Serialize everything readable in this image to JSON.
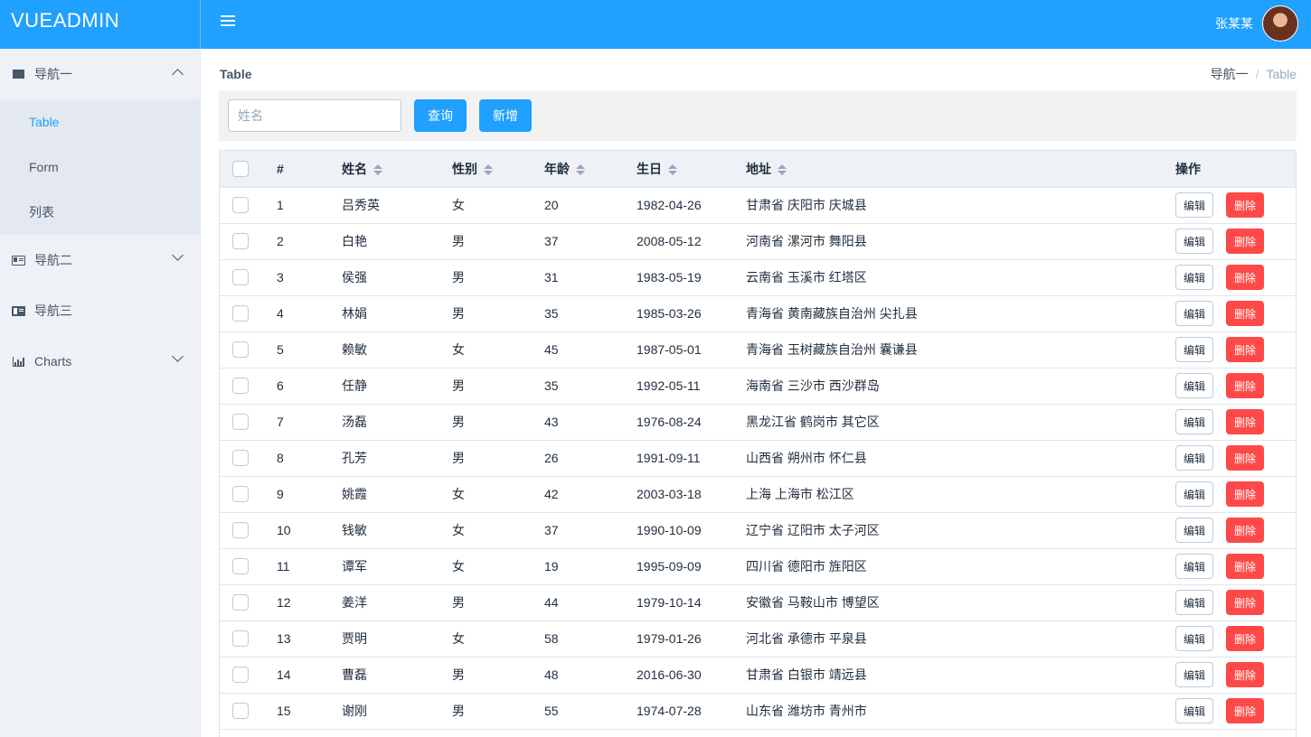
{
  "app": {
    "logo": "VUEADMIN",
    "user_name": "张某某"
  },
  "sidebar": {
    "groups": [
      {
        "label": "导航一",
        "icon": "envelope-icon",
        "expanded": true,
        "items": [
          {
            "label": "Table",
            "active": true
          },
          {
            "label": "Form",
            "active": false
          },
          {
            "label": "列表",
            "active": false
          }
        ]
      },
      {
        "label": "导航二",
        "icon": "id-card-icon",
        "expanded": false,
        "items": []
      },
      {
        "label": "导航三",
        "icon": "id-card-solid-icon",
        "expanded": false,
        "items": []
      },
      {
        "label": "Charts",
        "icon": "bar-chart-icon",
        "expanded": false,
        "items": []
      }
    ]
  },
  "page": {
    "title": "Table",
    "breadcrumb": [
      "导航一",
      "Table"
    ]
  },
  "toolbar": {
    "search_placeholder": "姓名",
    "search_value": "",
    "query_label": "查询",
    "add_label": "新增"
  },
  "table": {
    "columns": [
      "#",
      "姓名",
      "性别",
      "年龄",
      "生日",
      "地址",
      "操作"
    ],
    "sortable": [
      "姓名",
      "性别",
      "年龄",
      "生日",
      "地址"
    ],
    "edit_label": "编辑",
    "delete_label": "删除",
    "rows": [
      {
        "index": "1",
        "name": "吕秀英",
        "gender": "女",
        "age": "20",
        "birthday": "1982-04-26",
        "address": "甘肃省 庆阳市 庆城县"
      },
      {
        "index": "2",
        "name": "白艳",
        "gender": "男",
        "age": "37",
        "birthday": "2008-05-12",
        "address": "河南省 漯河市 舞阳县"
      },
      {
        "index": "3",
        "name": "侯强",
        "gender": "男",
        "age": "31",
        "birthday": "1983-05-19",
        "address": "云南省 玉溪市 红塔区"
      },
      {
        "index": "4",
        "name": "林娟",
        "gender": "男",
        "age": "35",
        "birthday": "1985-03-26",
        "address": "青海省 黄南藏族自治州 尖扎县"
      },
      {
        "index": "5",
        "name": "赖敏",
        "gender": "女",
        "age": "45",
        "birthday": "1987-05-01",
        "address": "青海省 玉树藏族自治州 囊谦县"
      },
      {
        "index": "6",
        "name": "任静",
        "gender": "男",
        "age": "35",
        "birthday": "1992-05-11",
        "address": "海南省 三沙市 西沙群岛"
      },
      {
        "index": "7",
        "name": "汤磊",
        "gender": "男",
        "age": "43",
        "birthday": "1976-08-24",
        "address": "黑龙江省 鹤岗市 其它区"
      },
      {
        "index": "8",
        "name": "孔芳",
        "gender": "男",
        "age": "26",
        "birthday": "1991-09-11",
        "address": "山西省 朔州市 怀仁县"
      },
      {
        "index": "9",
        "name": "姚霞",
        "gender": "女",
        "age": "42",
        "birthday": "2003-03-18",
        "address": "上海 上海市 松江区"
      },
      {
        "index": "10",
        "name": "钱敏",
        "gender": "女",
        "age": "37",
        "birthday": "1990-10-09",
        "address": "辽宁省 辽阳市 太子河区"
      },
      {
        "index": "11",
        "name": "谭军",
        "gender": "女",
        "age": "19",
        "birthday": "1995-09-09",
        "address": "四川省 德阳市 旌阳区"
      },
      {
        "index": "12",
        "name": "姜洋",
        "gender": "男",
        "age": "44",
        "birthday": "1979-10-14",
        "address": "安徽省 马鞍山市 博望区"
      },
      {
        "index": "13",
        "name": "贾明",
        "gender": "女",
        "age": "58",
        "birthday": "1979-01-26",
        "address": "河北省 承德市 平泉县"
      },
      {
        "index": "14",
        "name": "曹磊",
        "gender": "男",
        "age": "48",
        "birthday": "2016-06-30",
        "address": "甘肃省 白银市 靖远县"
      },
      {
        "index": "15",
        "name": "谢刚",
        "gender": "男",
        "age": "55",
        "birthday": "1974-07-28",
        "address": "山东省 潍坊市 青州市"
      }
    ]
  }
}
